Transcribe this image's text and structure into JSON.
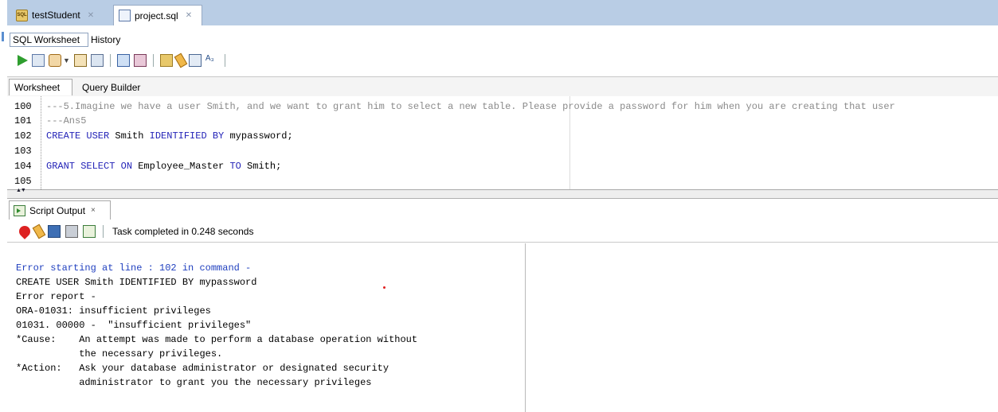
{
  "doc_tabs": [
    {
      "label": "testStudent",
      "icon": "database-connection-icon",
      "active": false
    },
    {
      "label": "project.sql",
      "icon": "sql-file-icon",
      "active": true
    }
  ],
  "ws_tabs": {
    "sql_worksheet": "SQL Worksheet",
    "history": "History"
  },
  "editor_tabs": {
    "worksheet": "Worksheet",
    "query_builder": "Query Builder"
  },
  "editor": {
    "lines": [
      {
        "number": "100",
        "text": "---5.Imagine we have a user Smith, and we want to grant him to select a new table. Please provide a password for him when you are creating that user"
      },
      {
        "number": "101",
        "text": "---Ans5"
      },
      {
        "number": "102",
        "kw1": "CREATE USER",
        "t1": " Smith ",
        "kw2": "IDENTIFIED BY",
        "t2": " mypassword;"
      },
      {
        "number": "103"
      },
      {
        "number": "104",
        "kw1": "GRANT SELECT ON",
        "t1": " Employee_Master ",
        "kw2": "TO",
        "t2": " Smith;"
      },
      {
        "number": "105"
      }
    ]
  },
  "output_panel": {
    "tab_label": "Script Output",
    "tab_close": "×",
    "status": "Task completed in 0.248 seconds",
    "lines": [
      "Error starting at line : 102 in command -",
      "CREATE USER Smith IDENTIFIED BY mypassword",
      "Error report -",
      "ORA-01031: insufficient privileges",
      "01031. 00000 -  \"insufficient privileges\"",
      "*Cause:    An attempt was made to perform a database operation without",
      "           the necessary privileges.",
      "*Action:   Ask your database administrator or designated security",
      "           administrator to grant you the necessary privileges"
    ]
  },
  "colors": {
    "tab_bar": "#b9cde5",
    "keyword": "#2424b8",
    "comment": "#8a8a8a",
    "output_error_heading": "#1f3fbf"
  }
}
